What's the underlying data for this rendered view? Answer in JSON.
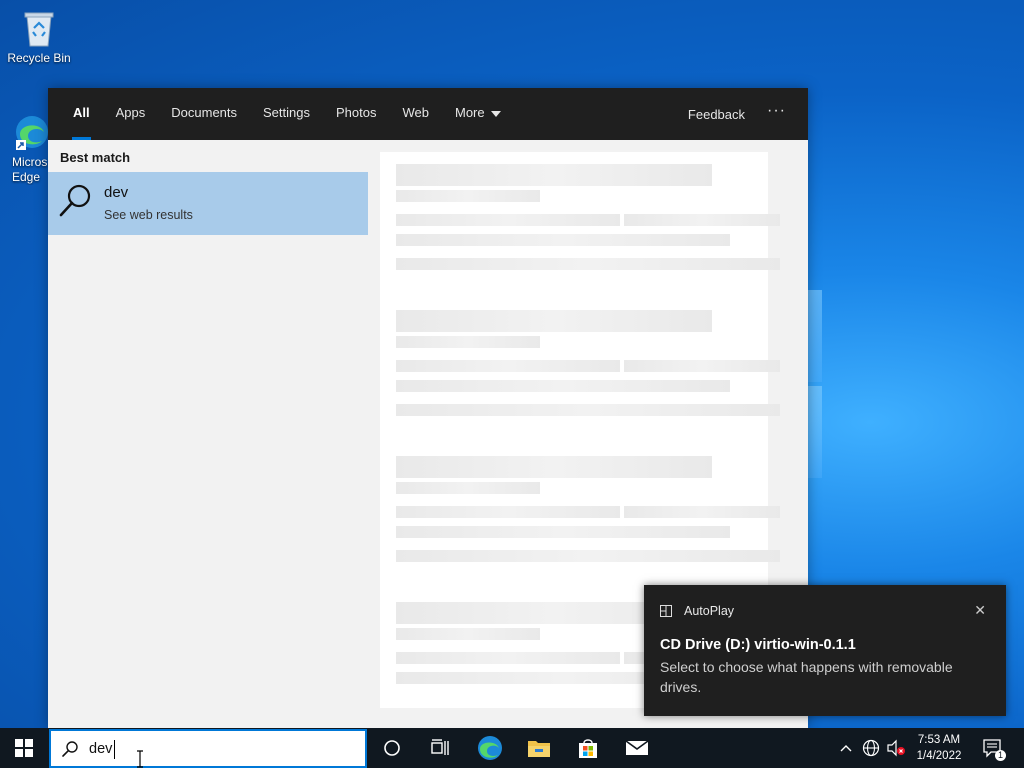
{
  "desktop": {
    "icons": [
      {
        "label": "Recycle Bin",
        "icon": "recycle-bin-icon"
      },
      {
        "label": "Micros\nEdge",
        "icon": "edge-shortcut-icon"
      }
    ]
  },
  "search": {
    "tabs": [
      {
        "label": "All",
        "active": true
      },
      {
        "label": "Apps"
      },
      {
        "label": "Documents"
      },
      {
        "label": "Settings"
      },
      {
        "label": "Photos"
      },
      {
        "label": "Web"
      },
      {
        "label": "More"
      }
    ],
    "feedback_label": "Feedback",
    "more_options_label": "···",
    "best_match_header": "Best match",
    "best_match": {
      "title": "dev",
      "subtitle": "See web results",
      "icon": "search-icon"
    },
    "query": "dev"
  },
  "toast": {
    "app_name": "AutoPlay",
    "title": "CD Drive (D:) virtio-win-0.1.1",
    "body": "Select to choose what happens with removable drives.",
    "close_icon": "close-icon"
  },
  "taskbar": {
    "pinned": [
      "cortana-icon",
      "task-view-icon",
      "edge-icon",
      "file-explorer-icon",
      "store-icon",
      "mail-icon"
    ],
    "time": "7:53 AM",
    "date": "1/4/2022",
    "notification_count": "1"
  },
  "colors": {
    "accent": "#0078d7",
    "selected_result": "#a8cbea",
    "taskbar": "#101820",
    "toast_bg": "#1f1f1f"
  }
}
